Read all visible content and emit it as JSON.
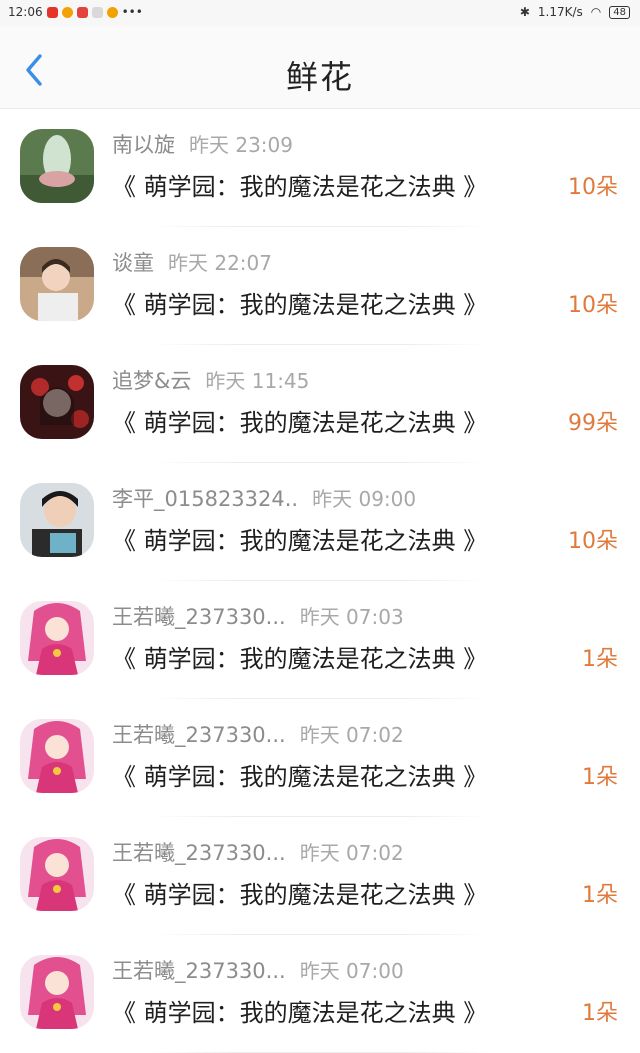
{
  "status_bar": {
    "time": "12:06",
    "speed": "1.17K/s",
    "battery": "48"
  },
  "header": {
    "title": "鲜花"
  },
  "rows": [
    {
      "name": "南以旋",
      "time": "昨天 23:09",
      "book": "《 萌学园：我的魔法是花之法典 》",
      "count": "10朵"
    },
    {
      "name": "谈童",
      "time": "昨天 22:07",
      "book": "《 萌学园：我的魔法是花之法典 》",
      "count": "10朵"
    },
    {
      "name": "追梦&云",
      "time": "昨天 11:45",
      "book": "《 萌学园：我的魔法是花之法典 》",
      "count": "99朵"
    },
    {
      "name": "李平_015823324..",
      "time": "昨天 09:00",
      "book": "《 萌学园：我的魔法是花之法典 》",
      "count": "10朵"
    },
    {
      "name": "王若曦_237330...",
      "time": "昨天 07:03",
      "book": "《 萌学园：我的魔法是花之法典 》",
      "count": "1朵"
    },
    {
      "name": "王若曦_237330...",
      "time": "昨天 07:02",
      "book": "《 萌学园：我的魔法是花之法典 》",
      "count": "1朵"
    },
    {
      "name": "王若曦_237330...",
      "time": "昨天 07:02",
      "book": "《 萌学园：我的魔法是花之法典 》",
      "count": "1朵"
    },
    {
      "name": "王若曦_237330...",
      "time": "昨天 07:00",
      "book": "《 萌学园：我的魔法是花之法典 》",
      "count": "1朵"
    }
  ],
  "colors": {
    "accent_blue": "#3a8ee6",
    "count_orange": "#e07a3c"
  }
}
